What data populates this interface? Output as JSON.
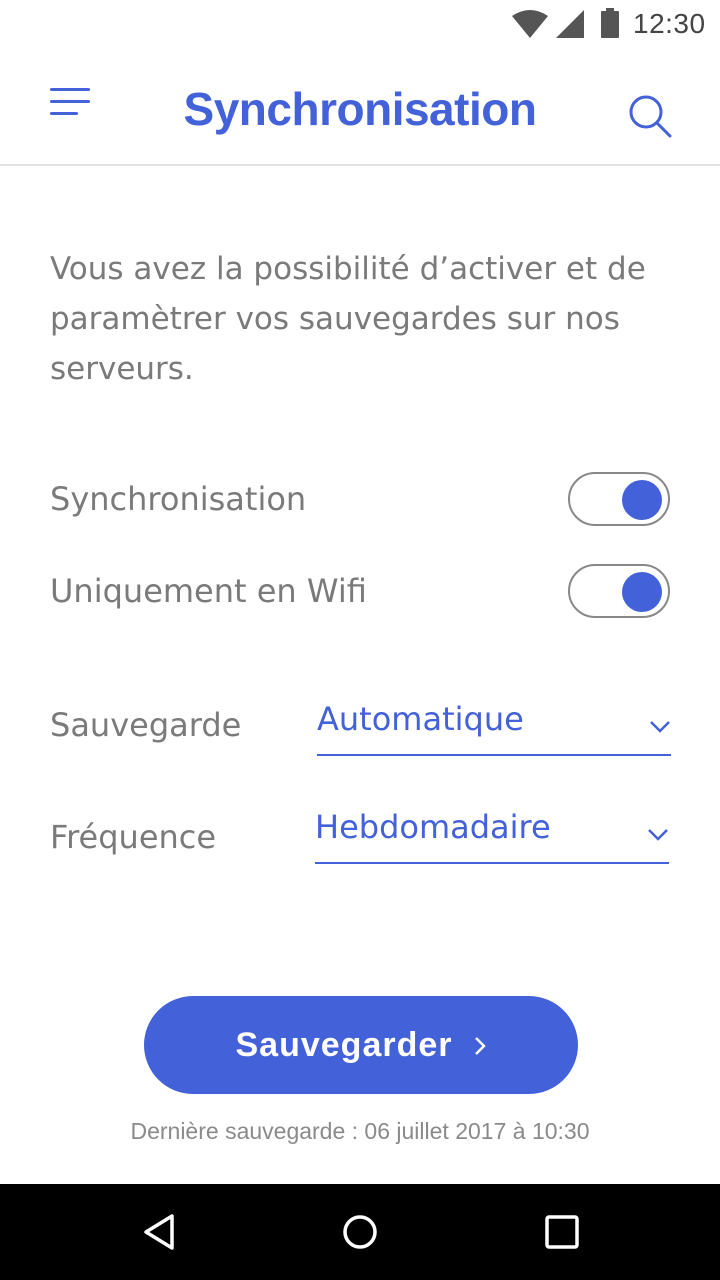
{
  "status_bar": {
    "time": "12:30",
    "icons": [
      "wifi-icon",
      "signal-icon",
      "battery-icon"
    ]
  },
  "app_bar": {
    "title": "Synchronisation",
    "menu_icon": "menu-icon",
    "search_icon": "search-icon"
  },
  "intro_text": "Vous avez la possibilité d’activer et de paramètrer vos sauvegardes sur nos serveurs.",
  "toggles": [
    {
      "label": "Synchronisation",
      "on": true
    },
    {
      "label": "Uniquement en Wifi",
      "on": true
    }
  ],
  "selects": [
    {
      "label": "Sauvegarde",
      "value": "Automatique"
    },
    {
      "label": "Fréquence",
      "value": "Hebdomadaire"
    }
  ],
  "save_button": {
    "label": "Sauvegarder",
    "icon": "chevron-right-icon"
  },
  "last_save": "Dernière sauvegarde : 06 juillet 2017 à 10:30",
  "nav_bar": {
    "icons": [
      "back-icon",
      "home-icon",
      "recents-icon"
    ]
  },
  "colors": {
    "accent": "#4361d8",
    "text_muted": "#7a7a7a",
    "nav_bar": "#000000"
  }
}
